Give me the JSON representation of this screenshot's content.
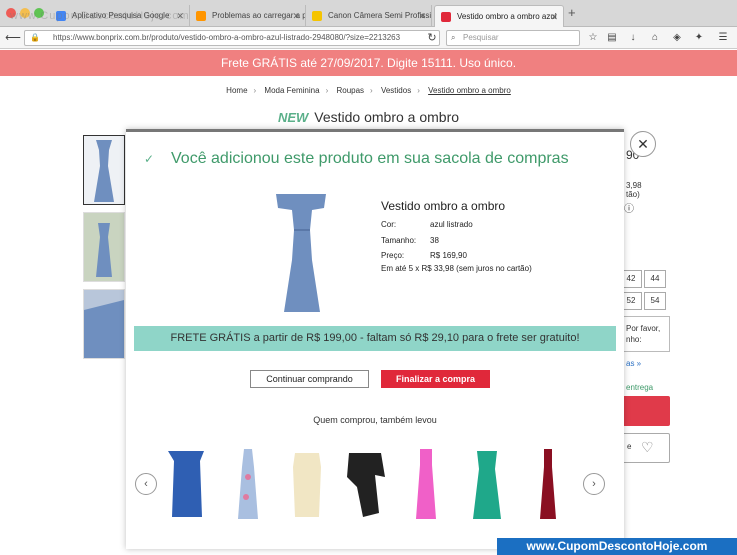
{
  "browser": {
    "tabs": [
      {
        "label": "Aplicativo Pesquisa Google"
      },
      {
        "label": "Problemas ao carregar a pág"
      },
      {
        "label": "Canon Câmera Semi Profissi"
      },
      {
        "label": "Vestido ombro a ombro azul"
      }
    ],
    "url": "https://www.bonprix.com.br/produto/vestido-ombro-a-ombro-azul-listrado-2948080/?size=2213263",
    "search_placeholder": "Pesquisar"
  },
  "promo": {
    "text": "Frete GRÁTIS até 27/09/2017. Digite 15111. Uso único."
  },
  "breadcrumb": [
    "Home",
    "Moda Feminina",
    "Roupas",
    "Vestidos",
    "Vestido ombro a ombro"
  ],
  "product_header": {
    "badge": "NEW",
    "title": "Vestido ombro a ombro"
  },
  "background_fragments": {
    "price_frag": "90",
    "inst_frag": "3,98",
    "note_frag": "tão)",
    "sizes": [
      "42",
      "44",
      "52",
      "54"
    ],
    "notice_frag_1": "Por favor,",
    "notice_frag_2": "nho:",
    "link_frag": "as »",
    "delivery_frag": "entrega",
    "wish_frag": "e"
  },
  "modal": {
    "confirmation": "Você adicionou este produto em sua sacola de compras",
    "product_name": "Vestido ombro a ombro",
    "rows": [
      {
        "label": "Cor:",
        "value": "azul listrado"
      },
      {
        "label": "Tamanho:",
        "value": "38"
      },
      {
        "label": "Preço:",
        "value": "R$ 169,90"
      }
    ],
    "installments": "Em até 5 x R$ 33,98 (sem juros no cartão)",
    "free_shipping": "FRETE GRÁTIS a partir de R$ 199,00 - faltam só R$ 29,10 para o frete ser gratuito!",
    "continue_label": "Continuar comprando",
    "checkout_label": "Finalizar a compra",
    "also_bought": "Quem comprou, também levou"
  },
  "watermark": {
    "text": "www.CupomDescontoHoje.com",
    "top_text": "www.CupomDescontoHoje.com"
  },
  "colors": {
    "promo": "#f08080",
    "accent_green": "#3f9a6a",
    "cta_red": "#e0283a",
    "frete_bg": "#8fd5c8"
  }
}
